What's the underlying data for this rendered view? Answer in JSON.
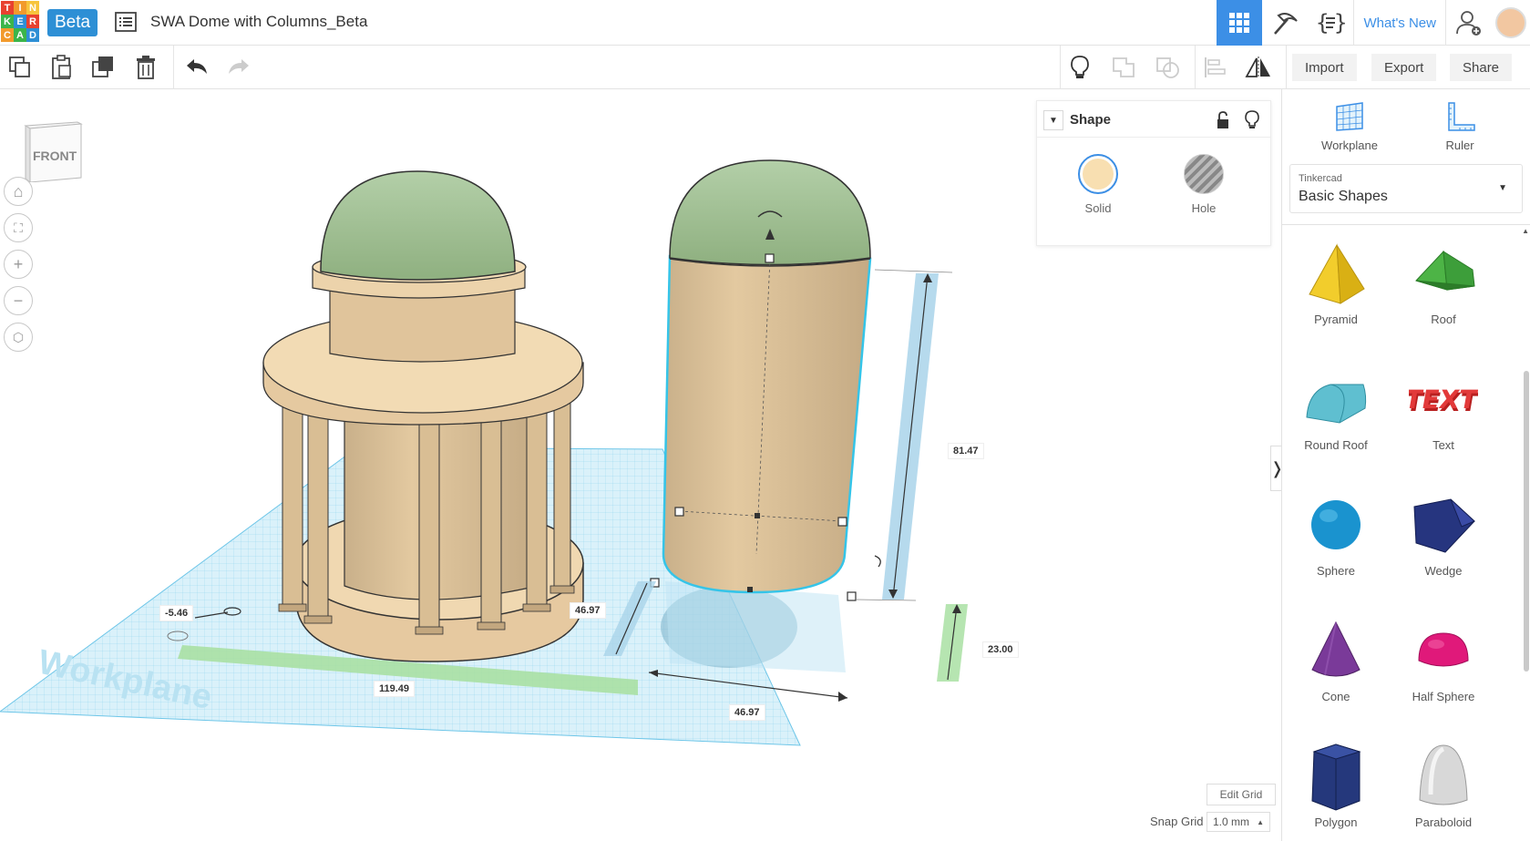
{
  "app": {
    "logo_letters": [
      "T",
      "I",
      "N",
      "K",
      "E",
      "R",
      "C",
      "A",
      "D"
    ],
    "logo_colors": [
      "#e8412f",
      "#f29a2c",
      "#f7c43c",
      "#3bb54a",
      "#2d8fd5",
      "#e8412f",
      "#f29a2c",
      "#3bb54a",
      "#2d8fd5"
    ],
    "beta_label": "Beta",
    "title": "SWA Dome with Columns_Beta",
    "whats_new": "What's New",
    "accent": "#3c8fe6"
  },
  "toolbar": {
    "copy": "copy-icon",
    "paste": "paste-icon",
    "duplicate": "duplicate-icon",
    "delete": "trash-icon",
    "undo": "undo-icon",
    "redo": "redo-icon",
    "import_label": "Import",
    "export_label": "Export",
    "share_label": "Share"
  },
  "viewport": {
    "view_cube_label": "FRONT",
    "workplane_label": "Workplane",
    "dimensions": {
      "height": "81.47",
      "elevation": "23.00",
      "width_top": "46.97",
      "width_bottom": "46.97",
      "x_offset": "119.49",
      "y_offset": "-5.46"
    }
  },
  "shape_panel": {
    "title": "Shape",
    "solid_label": "Solid",
    "hole_label": "Hole",
    "solid_color": "#f8dfb1"
  },
  "sidebar": {
    "workplane_label": "Workplane",
    "ruler_label": "Ruler",
    "library_caption": "Tinkercad",
    "library_value": "Basic Shapes",
    "shapes": [
      {
        "label": "Pyramid",
        "color": "#f2cd2c"
      },
      {
        "label": "Roof",
        "color": "#3d9e3a"
      },
      {
        "label": "Round Roof",
        "color": "#5fbfd0"
      },
      {
        "label": "Text",
        "color": "#d62f2f"
      },
      {
        "label": "Sphere",
        "color": "#1a93cf"
      },
      {
        "label": "Wedge",
        "color": "#26357f"
      },
      {
        "label": "Cone",
        "color": "#7a3a99"
      },
      {
        "label": "Half Sphere",
        "color": "#e0197a"
      },
      {
        "label": "Polygon",
        "color": "#25387c"
      },
      {
        "label": "Paraboloid",
        "color": "#d0d0d0"
      }
    ]
  },
  "grid": {
    "edit_label": "Edit Grid",
    "snap_label": "Snap Grid",
    "snap_value": "1.0 mm"
  }
}
